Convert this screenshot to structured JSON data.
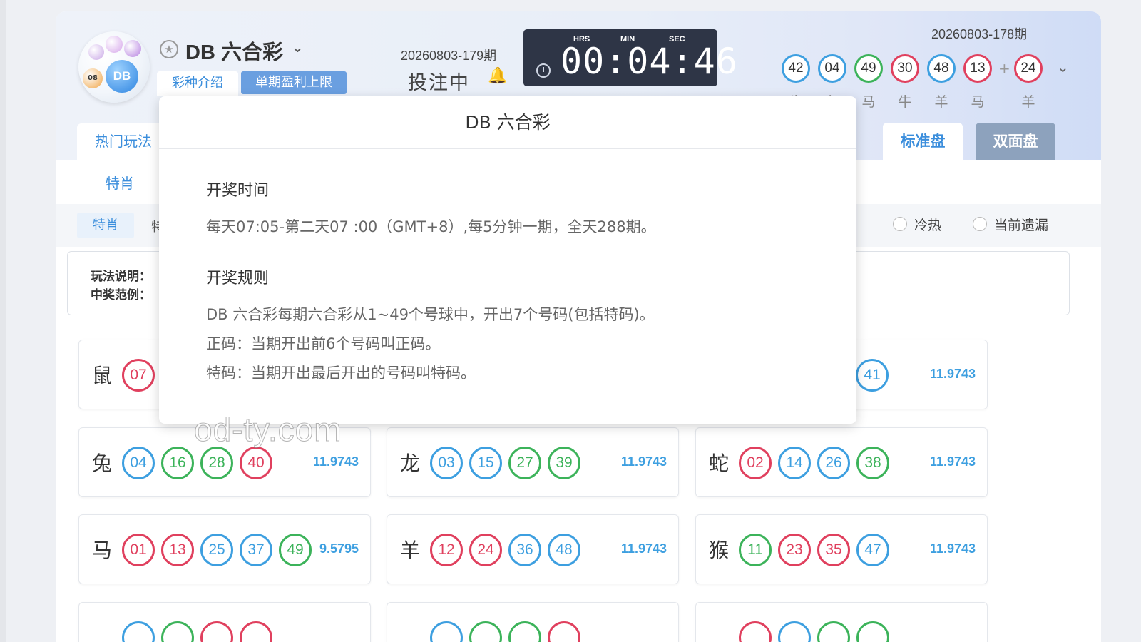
{
  "header": {
    "game_title": "DB 六合彩",
    "tabs": [
      "彩种介绍",
      "单期盈利上限"
    ],
    "current_issue": "20260803-179期",
    "status": "投注中",
    "countdown": {
      "labels": [
        "HRS",
        "MIN",
        "SEC"
      ],
      "time": "00:04:46"
    },
    "previous_issue": "20260803-178期",
    "results": [
      {
        "number": "42",
        "color": "#3d9fe0",
        "zodiac": "牛"
      },
      {
        "number": "04",
        "color": "#3d9fe0",
        "zodiac": "兔"
      },
      {
        "number": "49",
        "color": "#3cb35a",
        "zodiac": "马"
      },
      {
        "number": "30",
        "color": "#e0405e",
        "zodiac": "牛"
      },
      {
        "number": "48",
        "color": "#3d9fe0",
        "zodiac": "羊"
      },
      {
        "number": "13",
        "color": "#e0405e",
        "zodiac": "马"
      }
    ],
    "special": {
      "number": "24",
      "color": "#e0405e",
      "zodiac": "羊"
    },
    "plus": "+"
  },
  "nav": {
    "hot_tab": "热门玩法",
    "standard_tab": "标准盘",
    "double_tab": "双面盘",
    "sub_tab": "特肖",
    "chip_tab": "特肖",
    "next_tab": "特",
    "radio_hot_cold": "冷热",
    "radio_missing": "当前遗漏"
  },
  "rules": {
    "desc_label": "玩法说明：",
    "example_label": "中奖范例："
  },
  "popup": {
    "title": "DB 六合彩",
    "time_heading": "开奖时间",
    "time_text": "每天07:05-第二天07 :00（GMT+8）,每5分钟一期，全天288期。",
    "rule_heading": "开奖规则",
    "rule_lines": [
      "DB 六合彩每期六合彩从1~49个号球中，开出7个号码(包括特码)。",
      "正码：当期开出前6个号码叫正码。",
      "特码：当期开出最后开出的号码叫特码。"
    ]
  },
  "cards": [
    {
      "zodiac": "鼠",
      "balls": [
        {
          "n": "07",
          "c": "red"
        }
      ],
      "odds": ""
    },
    {
      "zodiac": "",
      "balls": [],
      "odds": ""
    },
    {
      "zodiac": "",
      "balls": [
        {
          "n": "41",
          "c": "blue"
        }
      ],
      "odds": "11.9743"
    },
    {
      "zodiac": "兔",
      "balls": [
        {
          "n": "04",
          "c": "blue"
        },
        {
          "n": "16",
          "c": "green"
        },
        {
          "n": "28",
          "c": "green"
        },
        {
          "n": "40",
          "c": "red"
        }
      ],
      "odds": "11.9743"
    },
    {
      "zodiac": "龙",
      "balls": [
        {
          "n": "03",
          "c": "blue"
        },
        {
          "n": "15",
          "c": "blue"
        },
        {
          "n": "27",
          "c": "green"
        },
        {
          "n": "39",
          "c": "green"
        }
      ],
      "odds": "11.9743"
    },
    {
      "zodiac": "蛇",
      "balls": [
        {
          "n": "02",
          "c": "red"
        },
        {
          "n": "14",
          "c": "blue"
        },
        {
          "n": "26",
          "c": "blue"
        },
        {
          "n": "38",
          "c": "green"
        }
      ],
      "odds": "11.9743"
    },
    {
      "zodiac": "马",
      "balls": [
        {
          "n": "01",
          "c": "red"
        },
        {
          "n": "13",
          "c": "red"
        },
        {
          "n": "25",
          "c": "blue"
        },
        {
          "n": "37",
          "c": "blue"
        },
        {
          "n": "49",
          "c": "green"
        }
      ],
      "odds": "9.5795"
    },
    {
      "zodiac": "羊",
      "balls": [
        {
          "n": "12",
          "c": "red"
        },
        {
          "n": "24",
          "c": "red"
        },
        {
          "n": "36",
          "c": "blue"
        },
        {
          "n": "48",
          "c": "blue"
        }
      ],
      "odds": "11.9743"
    },
    {
      "zodiac": "猴",
      "balls": [
        {
          "n": "11",
          "c": "green"
        },
        {
          "n": "23",
          "c": "red"
        },
        {
          "n": "35",
          "c": "red"
        },
        {
          "n": "47",
          "c": "blue"
        }
      ],
      "odds": "11.9743"
    },
    {
      "zodiac": "",
      "balls": [
        {
          "n": "",
          "c": "blue"
        },
        {
          "n": "",
          "c": "green"
        },
        {
          "n": "",
          "c": "red"
        },
        {
          "n": "",
          "c": "red"
        }
      ],
      "odds": ""
    },
    {
      "zodiac": "",
      "balls": [
        {
          "n": "",
          "c": "blue"
        },
        {
          "n": "",
          "c": "green"
        },
        {
          "n": "",
          "c": "green"
        },
        {
          "n": "",
          "c": "red"
        }
      ],
      "odds": ""
    },
    {
      "zodiac": "",
      "balls": [
        {
          "n": "",
          "c": "red"
        },
        {
          "n": "",
          "c": "blue"
        },
        {
          "n": "",
          "c": "green"
        },
        {
          "n": "",
          "c": "green"
        }
      ],
      "odds": ""
    }
  ],
  "watermark": "od-ty.com"
}
